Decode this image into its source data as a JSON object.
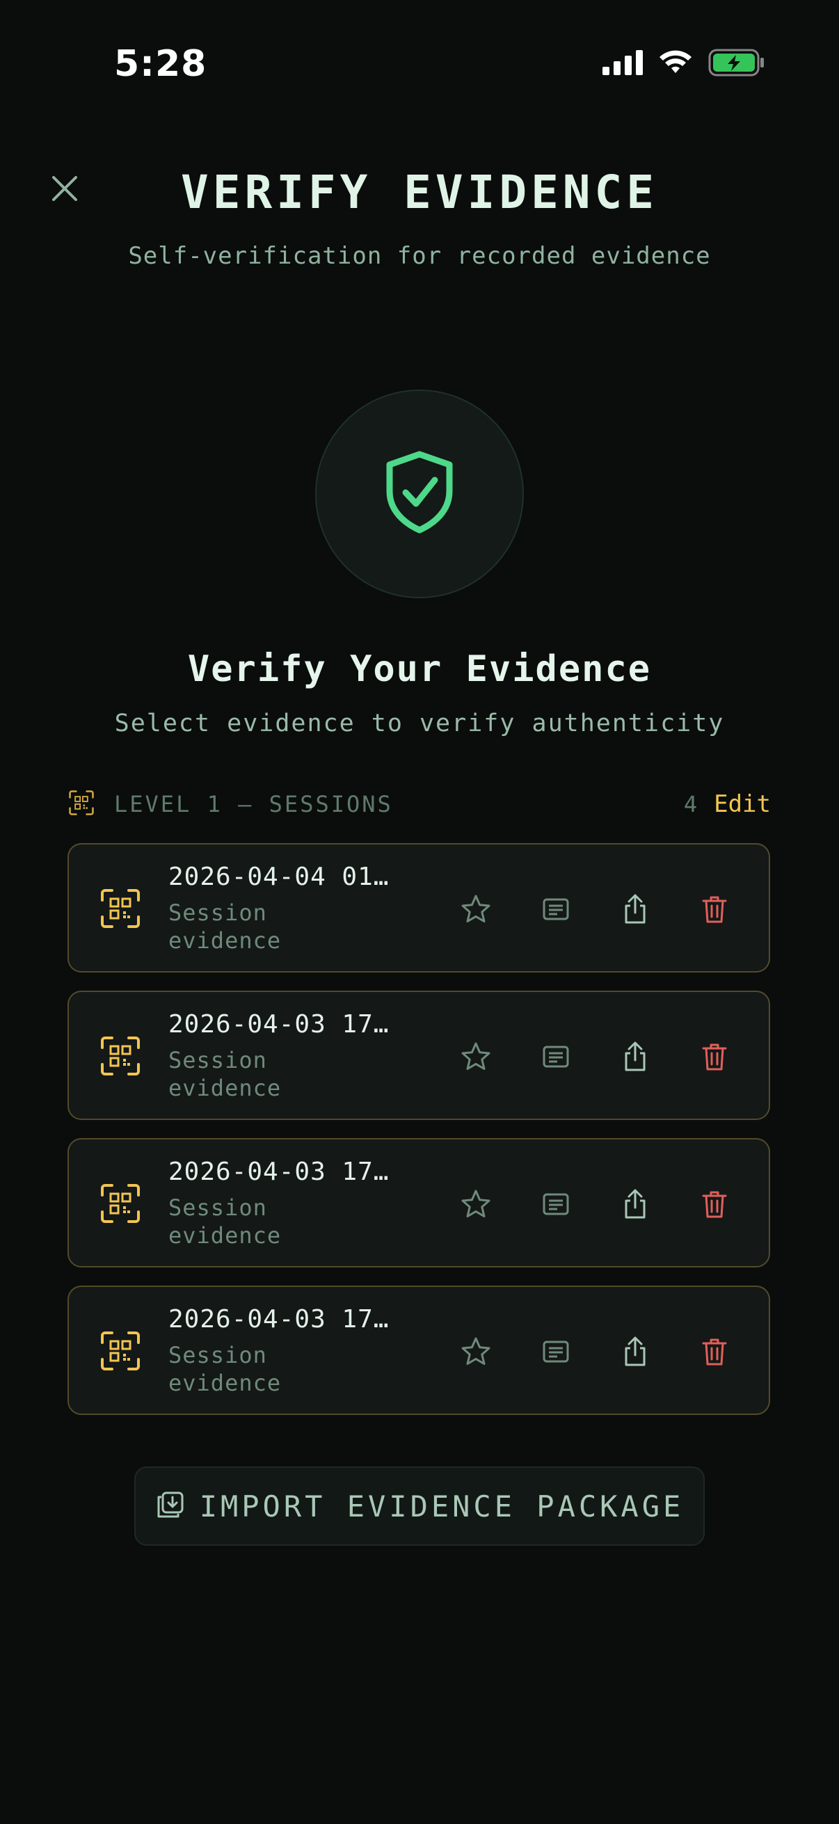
{
  "status_bar": {
    "time": "5:28"
  },
  "header": {
    "title": "VERIFY EVIDENCE",
    "subtitle": "Self-verification for recorded evidence"
  },
  "hero": {
    "title": "Verify Your Evidence",
    "subtitle": "Select evidence to verify authenticity"
  },
  "section": {
    "label": "LEVEL 1 — SESSIONS",
    "count": "4",
    "edit_label": "Edit"
  },
  "evidence_items": [
    {
      "title": "2026-04-04 01…",
      "description": "Session evidence"
    },
    {
      "title": "2026-04-03 17…",
      "description": "Session evidence"
    },
    {
      "title": "2026-04-03 17…",
      "description": "Session evidence"
    },
    {
      "title": "2026-04-03 17…",
      "description": "Session evidence"
    }
  ],
  "import_button": {
    "label": "IMPORT EVIDENCE PACKAGE"
  },
  "colors": {
    "accent_gold": "#f2c552",
    "accent_green": "#4ed88a",
    "danger_red": "#e0605a",
    "background": "#0a0d0c"
  }
}
